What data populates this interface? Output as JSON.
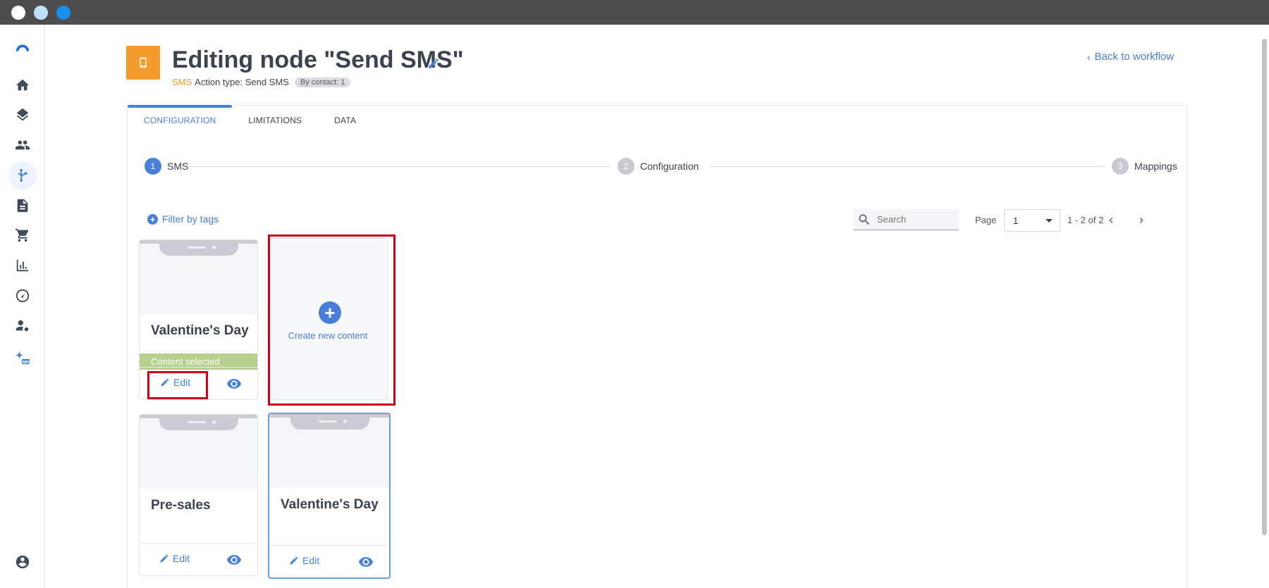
{
  "header": {
    "title": "Editing node \"Send SMS\"",
    "channel": "SMS",
    "action_type": "Action type: Send SMS",
    "contact_pill": "By contact: 1",
    "back_link": "Back to workflow"
  },
  "tabs": [
    {
      "label": "CONFIGURATION",
      "active": true
    },
    {
      "label": "LIMITATIONS",
      "active": false
    },
    {
      "label": "DATA",
      "active": false
    }
  ],
  "steps": [
    {
      "num": "1",
      "label": "SMS"
    },
    {
      "num": "2",
      "label": "Configuration"
    },
    {
      "num": "3",
      "label": "Mappings"
    }
  ],
  "toolbar": {
    "filter_label": "Filter by tags",
    "search_placeholder": "Search",
    "page_label": "Page",
    "page_value": "1",
    "range": "1 - 2 of 2"
  },
  "cards": [
    {
      "title": "Valentine's Day",
      "selected_label": "Content selected",
      "edit_label": "Edit"
    },
    {
      "title": "Pre-sales",
      "edit_label": "Edit"
    },
    {
      "title": "Valentine's Day",
      "edit_label": "Edit"
    }
  ],
  "create_card": {
    "label": "Create new content"
  },
  "colors": {
    "accent": "#4a7fd8",
    "node_badge": "#f39c2b",
    "selected_bar": "#b8d08e",
    "highlight": "#d0021b"
  },
  "icons": [
    "home-icon",
    "layers-icon",
    "people-icon",
    "workflow-icon",
    "document-icon",
    "cart-icon",
    "bar-chart-icon",
    "gauge-icon",
    "user-settings-icon",
    "sparkle-new-icon",
    "account-icon"
  ]
}
